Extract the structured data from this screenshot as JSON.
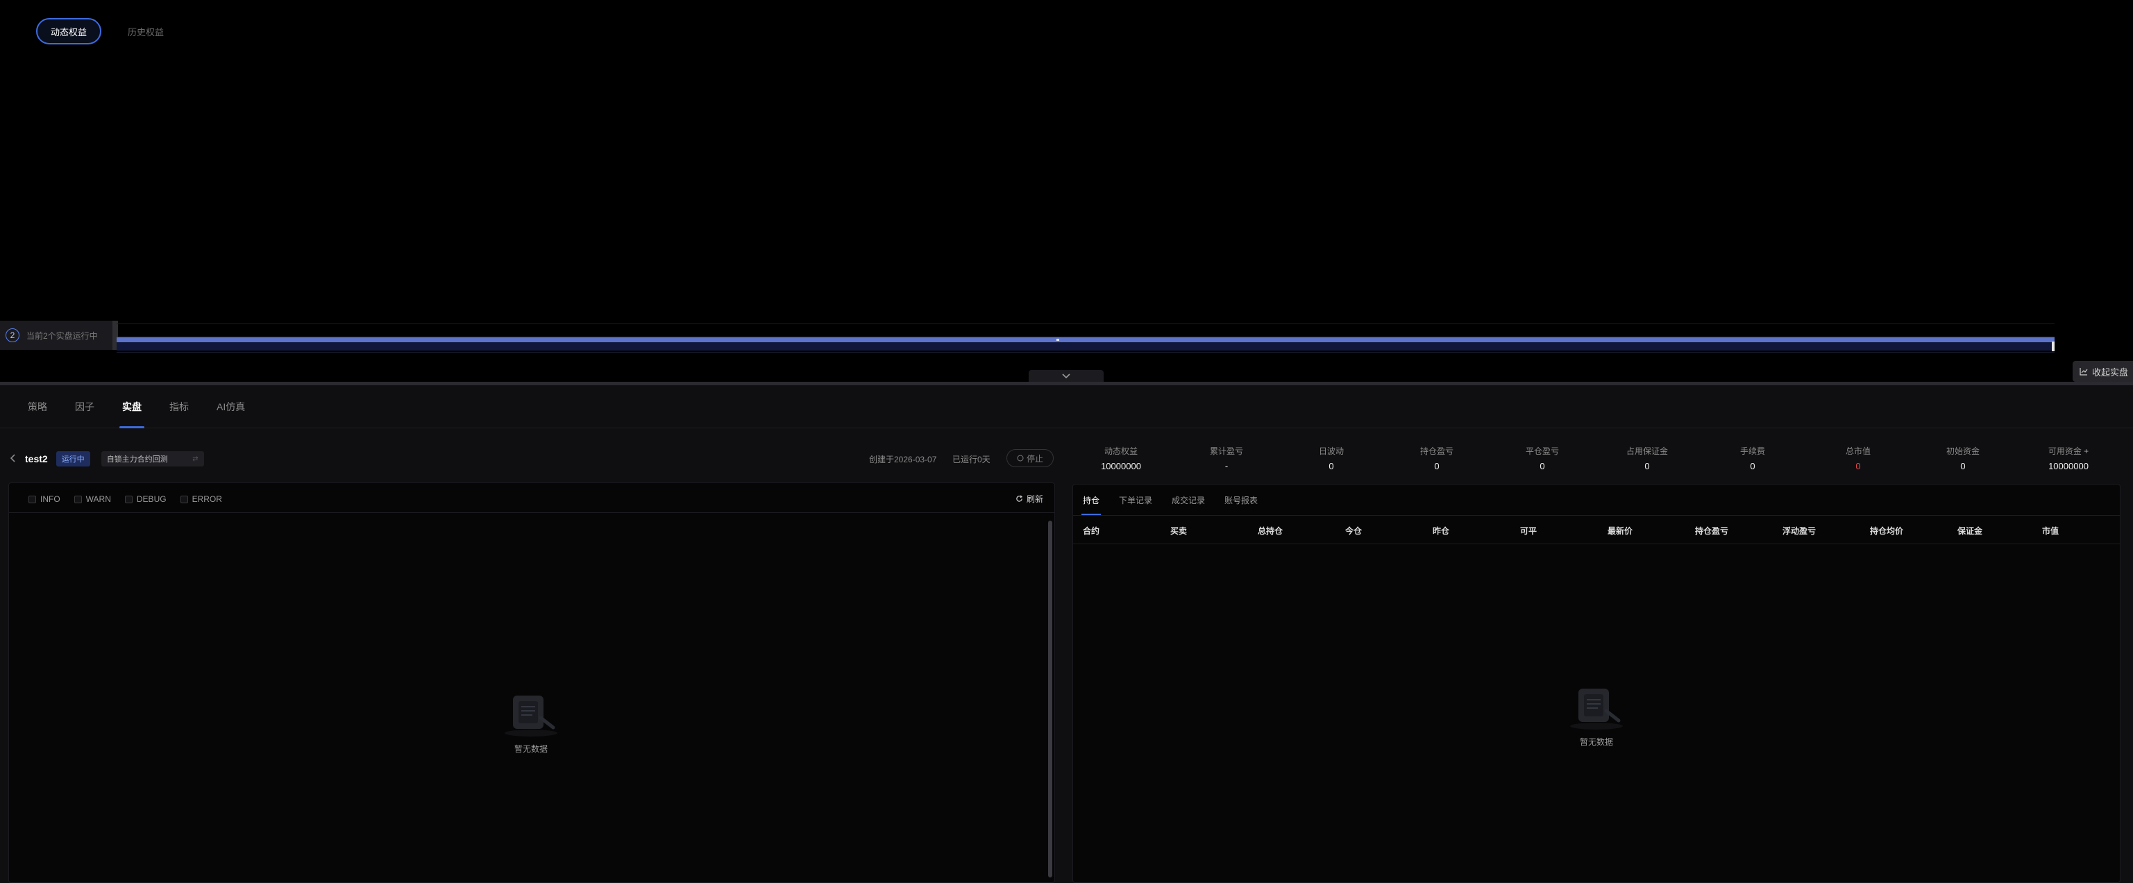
{
  "equity_tabs": {
    "dynamic": "动态权益",
    "history": "历史权益"
  },
  "live_bar": {
    "count": "2",
    "text": "当前2个实盘运行中"
  },
  "collapse_live": "收起实盘",
  "main_tabs": [
    "策略",
    "因子",
    "实盘",
    "指标",
    "AI仿真"
  ],
  "strategy": {
    "name": "test2",
    "status": "运行中",
    "contract_select": "自锁主力合约回测",
    "created": "创建于2026-03-07",
    "runtime": "已运行0天",
    "stop": "停止"
  },
  "metrics": [
    {
      "label": "动态权益",
      "value": "10000000"
    },
    {
      "label": "累计盈亏",
      "value": "-"
    },
    {
      "label": "日波动",
      "value": "0"
    },
    {
      "label": "持仓盈亏",
      "value": "0"
    },
    {
      "label": "平仓盈亏",
      "value": "0"
    },
    {
      "label": "占用保证金",
      "value": "0"
    },
    {
      "label": "手续费",
      "value": "0"
    },
    {
      "label": "总市值",
      "value": "0"
    },
    {
      "label": "初始资金",
      "value": "0"
    },
    {
      "label": "可用资金",
      "value": "10000000"
    }
  ],
  "log": {
    "filters": [
      "INFO",
      "WARN",
      "DEBUG",
      "ERROR"
    ],
    "refresh": "刷新",
    "empty": "暂无数据"
  },
  "positions": {
    "tabs": [
      "持仓",
      "下单记录",
      "成交记录",
      "账号报表"
    ],
    "columns": [
      "合约",
      "买卖",
      "总持仓",
      "今仓",
      "昨仓",
      "可平",
      "最新价",
      "持仓盈亏",
      "浮动盈亏",
      "持仓均价",
      "保证金",
      "市值"
    ],
    "empty": "暂无数据"
  },
  "colors": {
    "accent": "#3d6be0",
    "negative": "#e54848"
  },
  "icons": [
    "back-arrow-icon",
    "caret-icon",
    "stop-icon",
    "refresh-icon",
    "empty-box-icon",
    "chevron-down-icon",
    "chart-icon",
    "plus-icon"
  ]
}
